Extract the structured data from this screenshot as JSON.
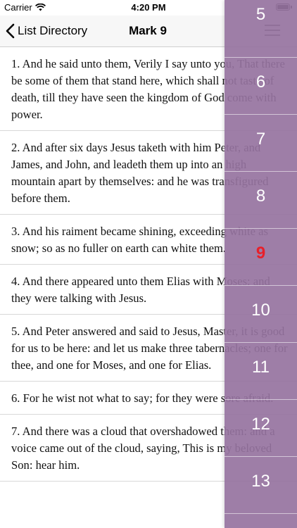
{
  "status_bar": {
    "carrier": "Carrier",
    "time": "4:20 PM",
    "battery_level": 1.0
  },
  "nav": {
    "back_label": "List Directory",
    "title": "Mark 9"
  },
  "verses": [
    "1. And he said unto them, Verily I say unto you, That there be some of them that stand here, which shall not taste of death, till they have seen the kingdom of God come with power.",
    "2. And after six days Jesus taketh with him Peter, and James, and John, and leadeth them up into an high mountain apart by themselves: and he was transfigured before them.",
    "3. And his raiment became shining, exceeding white as snow; so as no fuller on earth can white them.",
    "4. And there appeared unto them Elias with Moses: and they were talking with Jesus.",
    "5. And Peter answered and said to Jesus, Master, it is good for us to be here: and let us make three tabernacles; one for thee, and one for Moses, and one for Elias.",
    "6. For he wist not what to say; for they were sore afraid.",
    "7. And there was a cloud that overshadowed them: and a voice came out of the cloud, saying, This is my beloved Son: hear him."
  ],
  "chapters": [
    "5",
    "6",
    "7",
    "8",
    "9",
    "10",
    "11",
    "12",
    "13"
  ],
  "selected_chapter": "9",
  "colors": {
    "sidebar": "#9673a0",
    "selected_chapter": "#e8202a"
  }
}
